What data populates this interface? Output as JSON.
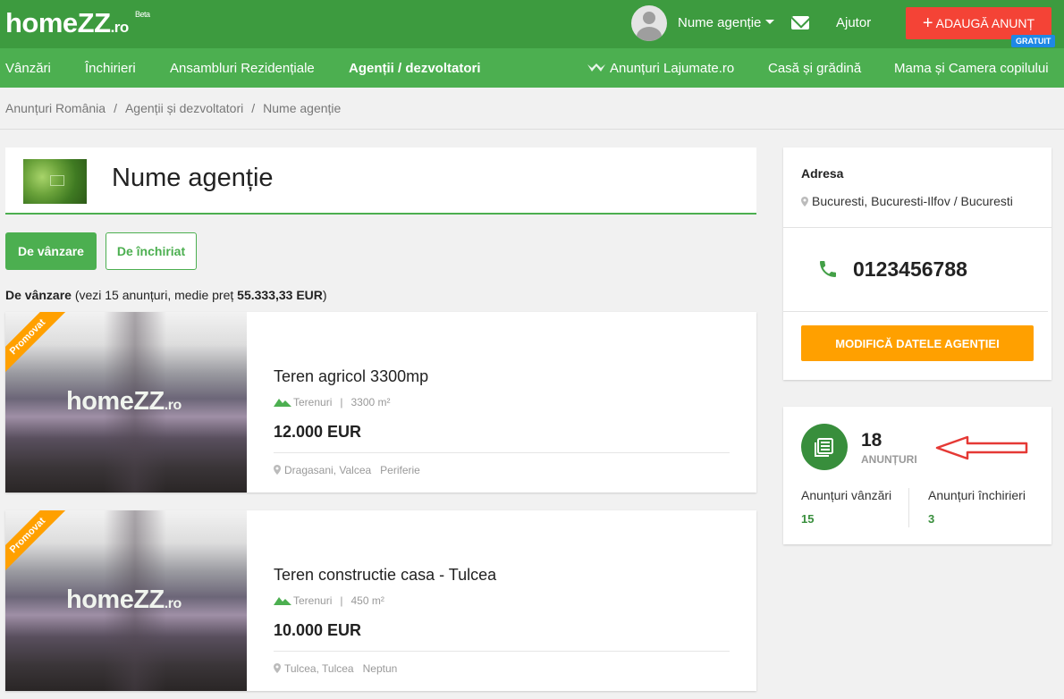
{
  "header": {
    "logo_main": "homeZZ",
    "logo_suffix": ".ro",
    "logo_badge": "Beta",
    "agency_menu_label": "Nume agenție",
    "help_label": "Ajutor",
    "add_button_label": "ADAUGĂ ANUNȚ",
    "free_badge": "GRATUIT",
    "brand_color": "#3d9b3f",
    "accent_color": "#f44336"
  },
  "nav": {
    "items": [
      {
        "label": "Vânzări"
      },
      {
        "label": "Închirieri"
      },
      {
        "label": "Ansambluri Rezidențiale"
      },
      {
        "label": "Agenții / dezvoltatori"
      },
      {
        "label": "Anunțuri Lajumate.ro"
      },
      {
        "label": "Casă și grădină"
      },
      {
        "label": "Mama și Camera copilului"
      }
    ],
    "active_index": 3
  },
  "breadcrumb": {
    "items": [
      "Anunțuri România",
      "Agenții și dezvoltatori",
      "Nume agenție"
    ],
    "separator": "/"
  },
  "agency": {
    "name": "Nume agenție"
  },
  "tabs": {
    "sale_label": "De vânzare",
    "rent_label": "De închiriat"
  },
  "summary": {
    "prefix": "De vânzare",
    "middle": " (vezi 15 anunțuri, medie preț ",
    "price": "55.333,33 EUR",
    "suffix": ")"
  },
  "listings": [
    {
      "promo": "Promovat",
      "img_logo": "homeZZ",
      "img_logo_suffix": ".ro",
      "title": "Teren agricol 3300mp",
      "category": "Terenuri",
      "area": "3300 m²",
      "price": "12.000 EUR",
      "location": "Dragasani, Valcea",
      "zone": "Periferie"
    },
    {
      "promo": "Promovat",
      "img_logo": "homeZZ",
      "img_logo_suffix": ".ro",
      "title": "Teren constructie casa - Tulcea",
      "category": "Terenuri",
      "area": "450 m²",
      "price": "10.000 EUR",
      "location": "Tulcea, Tulcea",
      "zone": "Neptun"
    }
  ],
  "contact": {
    "address_label": "Adresa",
    "address": "Bucuresti, Bucuresti-Ilfov / Bucuresti",
    "phone": "0123456788",
    "edit_button_label": "MODIFICĂ DATELE AGENȚIEI",
    "edit_button_color": "#ffa000"
  },
  "stats": {
    "total": "18",
    "total_label": "ANUNȚURI",
    "sales_label": "Anunțuri vânzări",
    "sales_count": "15",
    "rentals_label": "Anunțuri închirieri",
    "rentals_count": "3"
  }
}
